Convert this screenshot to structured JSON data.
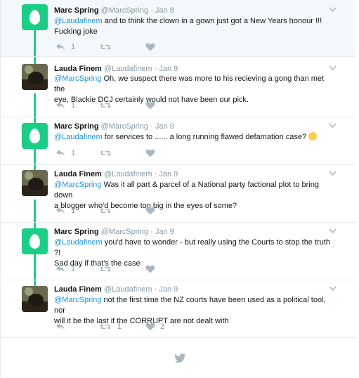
{
  "tweets": [
    {
      "name": "Marc Spring",
      "handle": "@MarcSpring",
      "sep": "·",
      "date": "Jan 8",
      "mention": "@Laudafinem",
      "text": " and to think the clown in a gown just got a New Years honour !!!",
      "text2": "Fucking joke",
      "reply_count": "1",
      "retweet_count": "",
      "like_count": ""
    },
    {
      "name": "Lauda Finem",
      "handle": "@Laudafinem",
      "sep": "·",
      "date": "Jan 9",
      "mention": "@MarcSpring",
      "text": " Oh, we suspect there was more to his recieving a gong than met the",
      "text2": "eye, Blackie DCJ certainly would not have been our pick.",
      "reply_count": "1",
      "retweet_count": "",
      "like_count": ""
    },
    {
      "name": "Marc Spring",
      "handle": "@MarcSpring",
      "sep": "·",
      "date": "Jan 9",
      "mention": "@Laudafinem",
      "text": " for services to ...... a long running flawed defamation case?",
      "text2": "",
      "reply_count": "1",
      "retweet_count": "",
      "like_count": ""
    },
    {
      "name": "Lauda Finem",
      "handle": "@Laudafinem",
      "sep": "·",
      "date": "Jan 9",
      "mention": "@MarcSpring",
      "text": " Was it all part & parcel of a National party factional plot to bring down",
      "text2": "a blogger who'd become too big in the eyes of some?",
      "reply_count": "1",
      "retweet_count": "",
      "like_count": ""
    },
    {
      "name": "Marc Spring",
      "handle": "@MarcSpring",
      "sep": "·",
      "date": "Jan 9",
      "mention": "@Laudafinem",
      "text": " you'd have to wonder - but really using the Courts to stop the truth ?!",
      "text2": "Sad day if that's the case",
      "reply_count": "1",
      "retweet_count": "",
      "like_count": ""
    },
    {
      "name": "Lauda Finem",
      "handle": "@Laudafinem",
      "sep": "·",
      "date": "Jan 9",
      "mention": "@MarcSpring",
      "text": " not the first time the NZ courts have been used as a political tool, nor",
      "text2": "will it be the last if the CORRUPT are not dealt with",
      "reply_count": "",
      "retweet_count": "1",
      "like_count": "2"
    }
  ],
  "colors": {
    "accent": "#1b95e0",
    "egg": "#19cf86",
    "muted": "#8899a6"
  },
  "icons": {
    "reply": "reply-icon",
    "retweet": "retweet-icon",
    "like": "heart-icon",
    "caret": "chevron-down-icon",
    "footer": "twitter-bird-icon"
  }
}
